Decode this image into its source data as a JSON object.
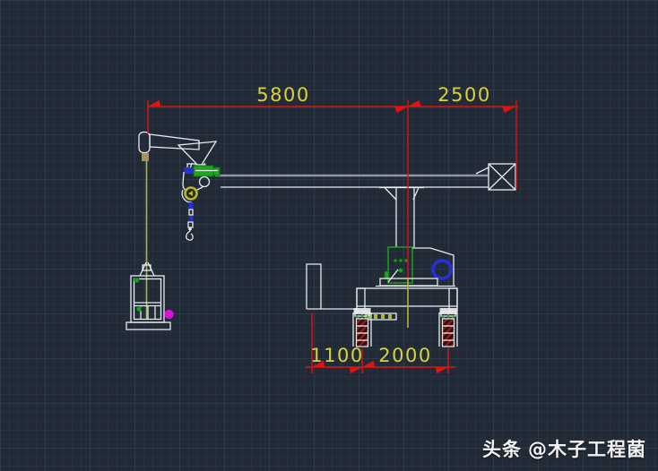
{
  "dimensions": {
    "top": [
      {
        "label": "5800"
      },
      {
        "label": "2500"
      }
    ],
    "bottom": [
      {
        "label": "1100"
      },
      {
        "label": "2000"
      }
    ]
  },
  "watermark": {
    "brand": "头条",
    "handle": "@木子工程菌"
  },
  "colors": {
    "background": "#222a35",
    "grid_minor": "#283140",
    "grid_major": "#2d3a4b",
    "dim_red": "#e01212",
    "dim_yellow": "#d8d23a",
    "outline_white": "#e9ebee",
    "beam_gray": "#8f959e",
    "cable_yellow": "#b4b82e",
    "accent_green": "#1ea41e",
    "accent_green_dark": "#0d6e0d",
    "accent_blue": "#2431d6",
    "accent_magenta": "#d416d4",
    "hatch_red": "#a82424",
    "hatch_dark": "#3a0e0e",
    "tan": "#a8905e"
  }
}
